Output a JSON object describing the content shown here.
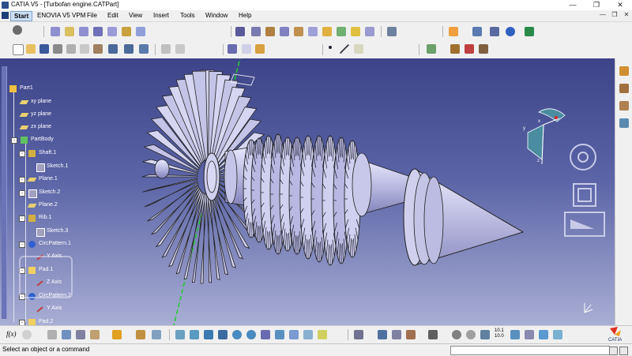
{
  "window": {
    "title": "CATIA V5 - [Turbofan engine.CATPart]",
    "controls": [
      "—",
      "❐",
      "✕"
    ]
  },
  "menubar": {
    "items": [
      "Start",
      "ENOVIA V5 VPM",
      "File",
      "Edit",
      "View",
      "Insert",
      "Tools",
      "Window",
      "Help"
    ],
    "mdi_controls": [
      "—",
      "❐",
      "✕"
    ]
  },
  "tree": {
    "items": [
      {
        "label": "Part1",
        "icon": "part-icon"
      },
      {
        "label": "xy plane",
        "icon": "plane-icon"
      },
      {
        "label": "yz plane",
        "icon": "plane-icon"
      },
      {
        "label": "zx plane",
        "icon": "plane-icon"
      },
      {
        "label": "PartBody",
        "icon": "partbody-gear-icon"
      },
      {
        "label": "Shaft.1",
        "icon": "shaft-icon"
      },
      {
        "label": "Sketch.1",
        "icon": "sketch-icon"
      },
      {
        "label": "Plane.1",
        "icon": "plane-icon"
      },
      {
        "label": "Sketch.2",
        "icon": "sketch-icon"
      },
      {
        "label": "Plane.2",
        "icon": "plane-icon"
      },
      {
        "label": "Rib.1",
        "icon": "rib-icon"
      },
      {
        "label": "Sketch.3",
        "icon": "sketch-icon"
      },
      {
        "label": "CircPattern.1",
        "icon": "circular-pattern-icon"
      },
      {
        "label": "Y Axis",
        "icon": "axis-icon"
      },
      {
        "label": "Pad.1",
        "icon": "pad-icon"
      },
      {
        "label": "Z Axis",
        "icon": "axis-icon"
      },
      {
        "label": "CircPattern.2",
        "icon": "circular-pattern-icon"
      },
      {
        "label": "Y Axis",
        "icon": "axis-icon"
      },
      {
        "label": "Pad.2",
        "icon": "pad-icon"
      }
    ]
  },
  "compass": {
    "axis_labels": [
      "x",
      "y",
      "z"
    ]
  },
  "bottom_toolbar": {
    "fx_label": "f(x)",
    "zoom_label_top": "10.1",
    "zoom_label_bottom": "10.0"
  },
  "status": {
    "message": "Select an object or a command",
    "command_placeholder": ""
  },
  "brand": {
    "logo_text": "CATIA"
  },
  "colors": {
    "viewport_top": "#3d4489",
    "viewport_bottom": "#a9aed4",
    "model_fill": "#c9c9ea",
    "axis_line": "#22cc33",
    "tree_text": "#ffffff"
  }
}
